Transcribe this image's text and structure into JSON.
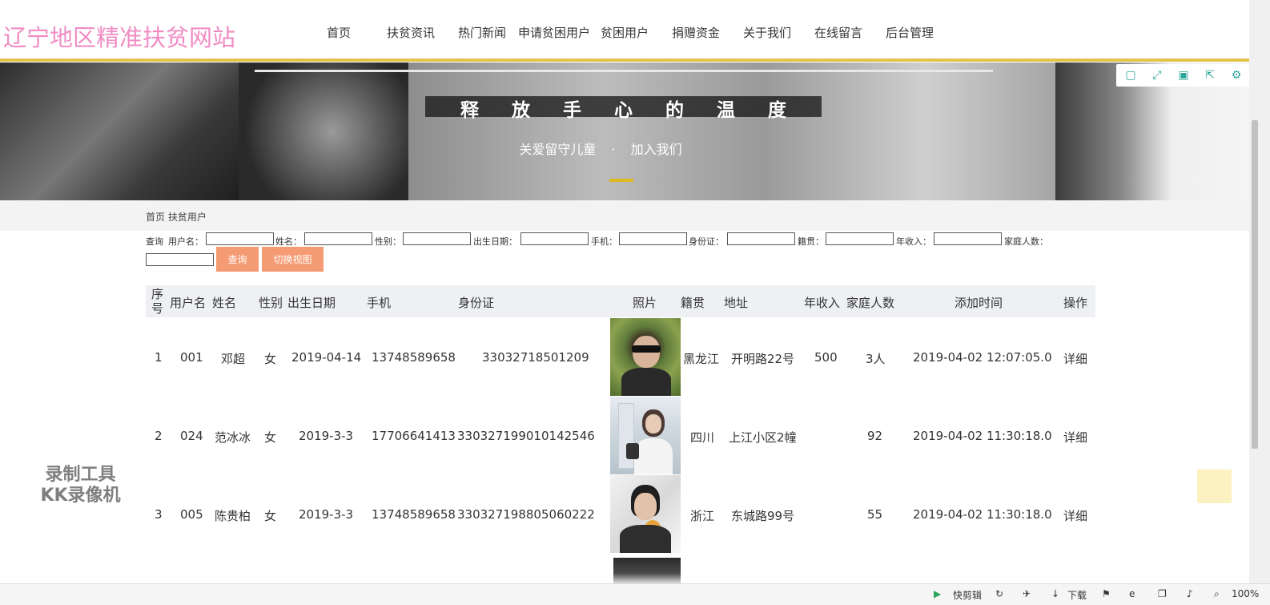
{
  "site": {
    "title": "辽宁地区精准扶贫网站"
  },
  "nav": [
    {
      "label": "首页"
    },
    {
      "label": "扶贫资讯"
    },
    {
      "label": "热门新闻"
    },
    {
      "label": "申请贫困用户"
    },
    {
      "label": "贫困用户"
    },
    {
      "label": "捐赠资金"
    },
    {
      "label": "关于我们"
    },
    {
      "label": "在线留言"
    },
    {
      "label": "后台管理"
    }
  ],
  "banner": {
    "slogan": "释放手心的温度",
    "sub_left": "关爱留守儿童",
    "sub_sep": "·",
    "sub_right": "加入我们"
  },
  "breadcrumb": {
    "home": "首页",
    "current": "扶贫用户"
  },
  "search": {
    "prefix": "查询",
    "fields": [
      {
        "label": "用户名：",
        "value": ""
      },
      {
        "label": "姓名：",
        "value": ""
      },
      {
        "label": "性别：",
        "value": ""
      },
      {
        "label": "出生日期：",
        "value": ""
      },
      {
        "label": "手机：",
        "value": ""
      },
      {
        "label": "身份证：",
        "value": ""
      },
      {
        "label": "籍贯：",
        "value": ""
      },
      {
        "label": "年收入：",
        "value": ""
      },
      {
        "label": "家庭人数：",
        "value": ""
      }
    ],
    "query_btn": "查询",
    "switch_btn": "切换视图"
  },
  "table": {
    "headers": {
      "seq": "序号",
      "username": "用户名",
      "name": "姓名",
      "gender": "性别",
      "birth": "出生日期",
      "phone": "手机",
      "idcard": "身份证",
      "photo": "照片",
      "native": "籍贯",
      "address": "地址",
      "income": "年收入",
      "family": "家庭人数",
      "added": "添加时间",
      "op": "操作"
    },
    "rows": [
      {
        "seq": "1",
        "username": "001",
        "name": "邓超",
        "gender": "女",
        "birth": "2019-04-14",
        "phone": "13748589658",
        "idcard": "33032718501209",
        "native": "黑龙江",
        "address": "开明路22号",
        "income": "500",
        "family": "3人",
        "added": "2019-04-02 12:07:05.0",
        "op": "详细"
      },
      {
        "seq": "2",
        "username": "024",
        "name": "范冰冰",
        "gender": "女",
        "birth": "2019-3-3",
        "phone": "17706641413",
        "idcard": "330327199010142546",
        "native": "四川",
        "address": "上江小区2幢",
        "income": "",
        "family": "92",
        "added": "2019-04-02 11:30:18.0",
        "op": "详细"
      },
      {
        "seq": "3",
        "username": "005",
        "name": "陈贵柏",
        "gender": "女",
        "birth": "2019-3-3",
        "phone": "13748589658",
        "idcard": "330327198805060222",
        "native": "浙江",
        "address": "东城路99号",
        "income": "",
        "family": "55",
        "added": "2019-04-02 11:30:18.0",
        "op": "详细"
      }
    ]
  },
  "watermark": {
    "line1": "录制工具",
    "line2": "KK录像机"
  },
  "statusbar": {
    "quick_edit": "快剪辑",
    "download": "下载",
    "zoom": "100%"
  }
}
